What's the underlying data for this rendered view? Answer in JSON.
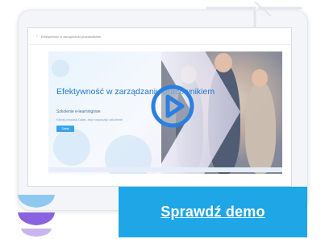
{
  "app": {
    "back_icon": "‹",
    "breadcrumb": "Efektywność w zarządzaniu pracownikiem"
  },
  "slide": {
    "title": "Efektywność w zarządzaniu pracownikiem",
    "subtitle": "Szkolenie e-learningowe",
    "note": "Kliknij przycisk Dalej, aby rozpocząć szkolenie",
    "button_label": "Dalej"
  },
  "cta": {
    "label": "Sprawdź demo"
  },
  "icons": {
    "play": "play-icon",
    "stack": "layers-icon"
  },
  "colors": {
    "accent": "#1fa6e6",
    "play": "#2b7fe0",
    "title": "#1f77c8",
    "stack_top": "#8fc8ef",
    "stack_bottom": "#8a62e0"
  }
}
